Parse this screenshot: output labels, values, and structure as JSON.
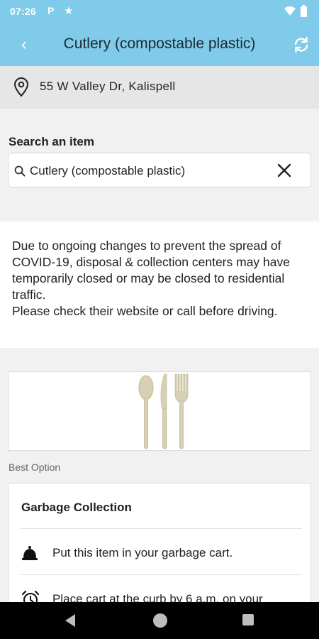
{
  "status_bar": {
    "time": "07:26",
    "p_glyph": "P",
    "star_glyph": "★"
  },
  "app_bar": {
    "back_glyph": "‹",
    "title": "Cutlery (compostable plastic)",
    "color": "#7fcbe9"
  },
  "address": {
    "text": "55 W Valley Dr, Kalispell"
  },
  "search": {
    "label": "Search an item",
    "value": "Cutlery (compostable plastic)"
  },
  "notice": {
    "text": "Due to ongoing changes to prevent the spread of COVID-19, disposal & collection centers may have temporarily closed or may be closed to residential traffic.\nPlease check their website or call before driving."
  },
  "best_option": {
    "label": "Best Option",
    "card": {
      "title": "Garbage Collection",
      "rows": [
        {
          "icon": "bell-icon",
          "text": "Put this item in your garbage cart."
        },
        {
          "icon": "alarm-clock-icon",
          "text": "Place cart at the curb by 6 a.m. on your"
        }
      ]
    }
  },
  "icons": {
    "back": "back-arrow-icon",
    "refresh": "refresh-icon",
    "location": "location-pin-icon",
    "search": "search-icon",
    "clear": "close-icon"
  }
}
